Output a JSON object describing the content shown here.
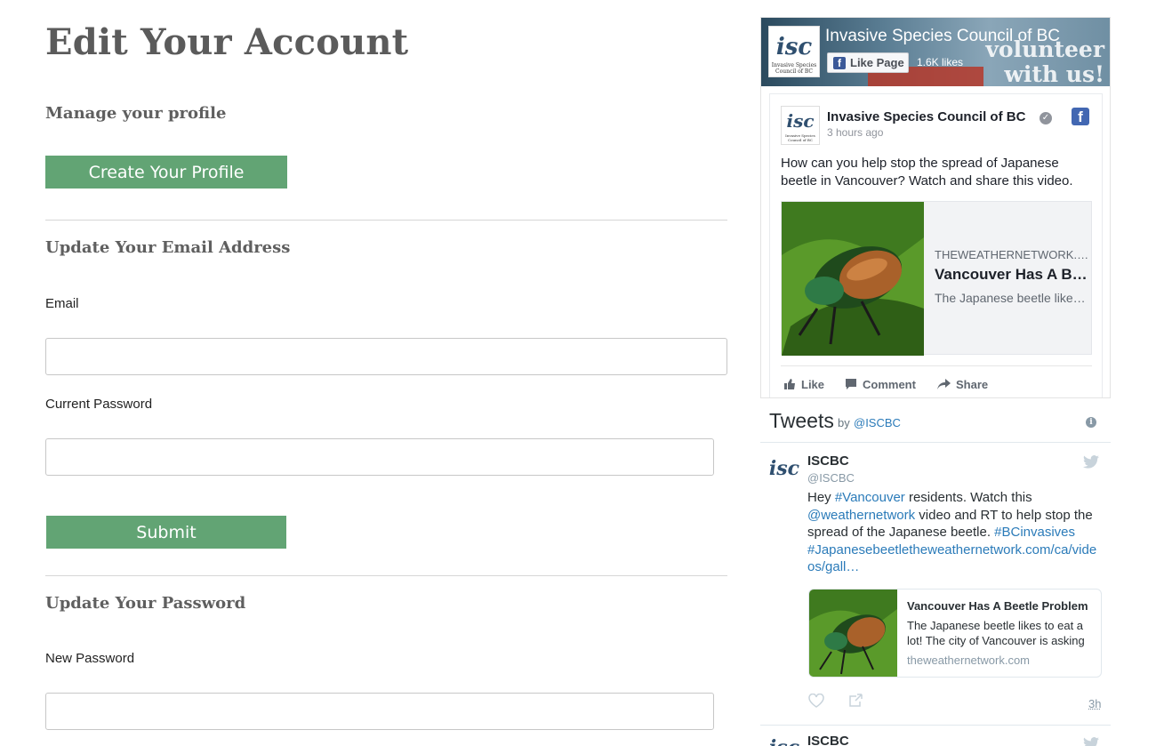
{
  "page": {
    "title": "Edit Your Account"
  },
  "profile": {
    "heading": "Manage your profile",
    "create_button": "Create Your Profile"
  },
  "email_section": {
    "heading": "Update Your Email Address",
    "email_label": "Email",
    "email_value": "",
    "password_label": "Current Password",
    "password_value": "",
    "submit_button": "Submit"
  },
  "password_section": {
    "heading": "Update Your Password",
    "new_password_label": "New Password",
    "new_password_value": ""
  },
  "facebook": {
    "page_name": "Invasive Species Council of BC",
    "like_page_button": "Like Page",
    "likes_count": "1.6K likes",
    "cover_text": "volunteer with us!",
    "logo_text": "isc",
    "logo_caption": "Invasive Species Council of BC",
    "post": {
      "author": "Invasive Species Council of BC",
      "time": "3 hours ago",
      "text": "How can you help stop the spread of Japanese beetle in Vancouver? Watch and share this video.",
      "link": {
        "domain": "THEWEATHERNETWORK.COM",
        "title": "Vancouver Has A Beetle Problem",
        "description": "The Japanese beetle likes to eat a lot!"
      }
    },
    "actions": {
      "like": "Like",
      "comment": "Comment",
      "share": "Share"
    }
  },
  "twitter": {
    "header_title": "Tweets",
    "header_by": "by",
    "header_handle": "@ISCBC",
    "tweet": {
      "author": "ISCBC",
      "handle": "@ISCBC",
      "text_parts": {
        "p1": "Hey ",
        "l1": "#Vancouver",
        "p2": " residents. Watch this ",
        "l2": "@weathernetwork",
        "p3": " video and RT to help stop the spread of the Japanese beetle. ",
        "l3": "#BCinvasives",
        "l4": "#Japanesebeetle",
        "l5": "theweathernetwork.com/ca/videos/gall…"
      },
      "card": {
        "title": "Vancouver Has A Beetle Problem",
        "description": "The Japanese beetle likes to eat a lot! The city of Vancouver is asking",
        "domain": "theweathernetwork.com"
      },
      "timestamp": "3h"
    },
    "next_tweet_author": "ISCBC"
  },
  "colors": {
    "accent_green": "#62a474",
    "facebook_blue": "#4267b2",
    "twitter_link": "#2b7bb9"
  },
  "icons": [
    "facebook-f-icon",
    "verified-icon",
    "thumbs-up-icon",
    "comment-icon",
    "share-arrow-icon",
    "info-icon",
    "twitter-bird-icon",
    "heart-icon",
    "share-icon"
  ]
}
